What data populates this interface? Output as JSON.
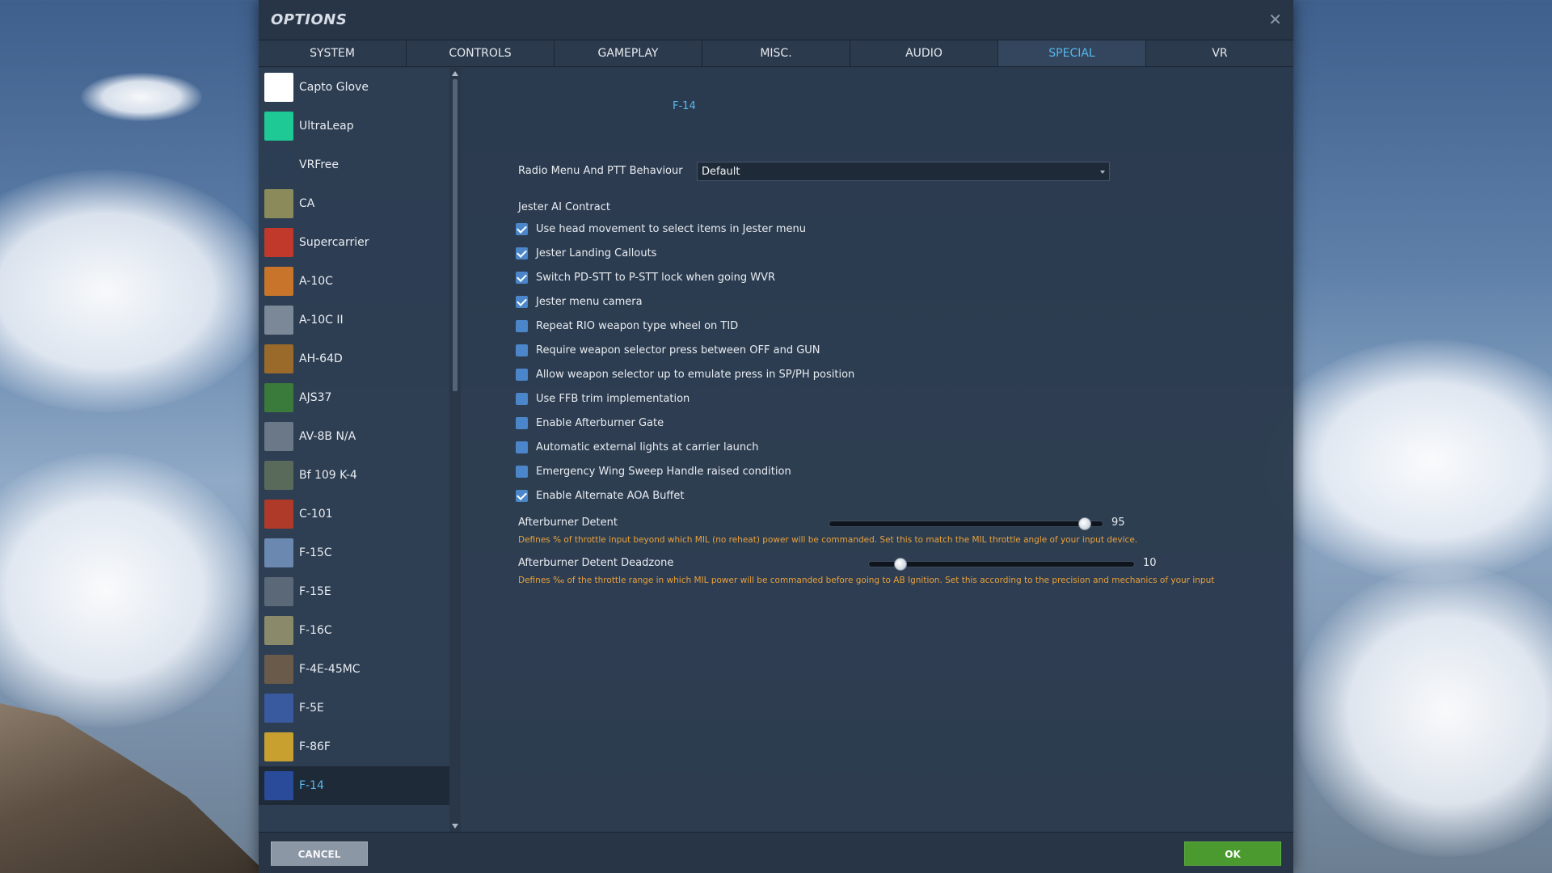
{
  "dialog": {
    "title": "OPTIONS"
  },
  "tabs": [
    {
      "label": "SYSTEM"
    },
    {
      "label": "CONTROLS"
    },
    {
      "label": "GAMEPLAY"
    },
    {
      "label": "MISC."
    },
    {
      "label": "AUDIO"
    },
    {
      "label": "SPECIAL"
    },
    {
      "label": "VR"
    }
  ],
  "active_tab": "SPECIAL",
  "sidebar": {
    "items": [
      {
        "label": "Capto Glove",
        "icon": "capto-glove-icon",
        "color": "#ffffff"
      },
      {
        "label": "UltraLeap",
        "icon": "ultraleap-icon",
        "color": "#1ec995"
      },
      {
        "label": "VRFree",
        "icon": "vrfree-icon",
        "color": "#2c3e54"
      },
      {
        "label": "CA",
        "icon": "ca-icon",
        "color": "#8a8a5a"
      },
      {
        "label": "Supercarrier",
        "icon": "supercarrier-icon",
        "color": "#c0392b"
      },
      {
        "label": "A-10C",
        "icon": "a10c-icon",
        "color": "#c8742a"
      },
      {
        "label": "A-10C II",
        "icon": "a10c-ii-icon",
        "color": "#7a8898"
      },
      {
        "label": "AH-64D",
        "icon": "ah64d-icon",
        "color": "#9a6a2a"
      },
      {
        "label": "AJS37",
        "icon": "ajs37-icon",
        "color": "#3a7a3a"
      },
      {
        "label": "AV-8B N/A",
        "icon": "av8b-icon",
        "color": "#6a7888"
      },
      {
        "label": "Bf 109 K-4",
        "icon": "bf109-icon",
        "color": "#5a6a5a"
      },
      {
        "label": "C-101",
        "icon": "c101-icon",
        "color": "#b03a2a"
      },
      {
        "label": "F-15C",
        "icon": "f15c-icon",
        "color": "#6a88b0"
      },
      {
        "label": "F-15E",
        "icon": "f15e-icon",
        "color": "#5a6878"
      },
      {
        "label": "F-16C",
        "icon": "f16c-icon",
        "color": "#8a8a6a"
      },
      {
        "label": "F-4E-45MC",
        "icon": "f4e-icon",
        "color": "#6a5a4a"
      },
      {
        "label": "F-5E",
        "icon": "f5e-icon",
        "color": "#3a5aa0"
      },
      {
        "label": "F-86F",
        "icon": "f86f-icon",
        "color": "#c8a030"
      },
      {
        "label": "F-14",
        "icon": "f14-icon",
        "color": "#2a4a9a"
      }
    ],
    "selected": "F-14"
  },
  "content": {
    "section_title": "F-14",
    "radio_menu": {
      "label": "Radio Menu And PTT Behaviour",
      "value": "Default"
    },
    "group_label": "Jester AI Contract",
    "checkboxes": [
      {
        "label": "Use head movement to select items in Jester menu",
        "checked": true
      },
      {
        "label": "Jester Landing Callouts",
        "checked": true
      },
      {
        "label": "Switch PD-STT to P-STT lock when going WVR",
        "checked": true
      },
      {
        "label": "Jester menu camera",
        "checked": true
      },
      {
        "label": "Repeat RIO weapon type wheel on TID",
        "checked": false
      },
      {
        "label": "Require weapon selector press between OFF and GUN",
        "checked": false
      },
      {
        "label": "Allow weapon selector up to emulate press in SP/PH position",
        "checked": false
      },
      {
        "label": "Use FFB trim implementation",
        "checked": false
      },
      {
        "label": "Enable Afterburner Gate",
        "checked": false
      },
      {
        "label": "Automatic external lights at carrier launch",
        "checked": false
      },
      {
        "label": "Emergency Wing Sweep Handle raised condition",
        "checked": false
      },
      {
        "label": "Enable Alternate AOA Buffet",
        "checked": true
      }
    ],
    "sliders": [
      {
        "label": "Afterburner Detent",
        "value": "95",
        "level": 0.95,
        "hint": "Defines % of throttle input beyond which MIL (no reheat) power will be commanded. Set this to match the MIL throttle angle of your input device."
      },
      {
        "label": "Afterburner Detent Deadzone",
        "value": "10",
        "level": 0.1,
        "hint": "Defines ‰ of the throttle range in which MIL power will be commanded before going to AB Ignition. Set this according to the precision and mechanics of your input"
      }
    ]
  },
  "footer": {
    "cancel_label": "CANCEL",
    "ok_label": "OK"
  },
  "colors": {
    "accent": "#57b8ee",
    "ok": "#4b9a30",
    "hint": "#e9a23b",
    "checkbox": "#4a86c9"
  }
}
